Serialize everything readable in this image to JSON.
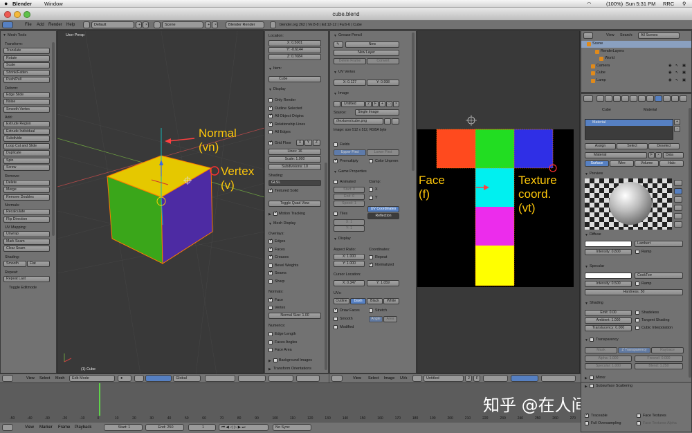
{
  "menubar": {
    "app": "Blender",
    "menu": "Window",
    "battery": "(100%)",
    "clock": "Sun 5:31 PM",
    "user": "RRC"
  },
  "window": {
    "title": "cube.blend"
  },
  "info": {
    "menus": [
      "File",
      "Add",
      "Render",
      "Help"
    ],
    "layout": "Default",
    "scene": "Scene",
    "engine": "Blender Render",
    "stats": "blender.org 262 | Ve:8-8 | Ed:12-12 | Fa:6-6 | Cube"
  },
  "tools": {
    "title": "Mesh Tools",
    "transform_h": "Transform:",
    "transform": [
      "Translate",
      "Rotate",
      "Scale",
      "Shrink/Fatten",
      "Push/Pull"
    ],
    "deform_h": "Deform:",
    "deform": [
      "Edge Slide",
      "Noise",
      "Smooth Vertex"
    ],
    "add_h": "Add:",
    "add": [
      "Extrude Region",
      "Extrude Individual",
      "Subdivide",
      "Loop Cut and Slide",
      "Duplicate",
      "Spin",
      "Screw"
    ],
    "remove_h": "Remove:",
    "remove": [
      "Delete",
      "Merge",
      "Remove Doubles"
    ],
    "normals_h": "Normals:",
    "normals": [
      "Recalculate",
      "Flip Direction"
    ],
    "uv_h": "UV Mapping:",
    "uv": [
      "Unwrap",
      "Mark Seam",
      "Clear Seam"
    ],
    "shading_h": "Shading:",
    "smooth": "Smooth",
    "flat": "Flat",
    "repeat_h": "Repeat:",
    "repeat_last": "Repeat Last",
    "toggle": "Toggle Editmode"
  },
  "viewport": {
    "label": "User Persp",
    "object": "(1) Cube",
    "normal": "Normal\n(vn)",
    "vertex": "Vertex\n(v)",
    "normal_l1": "Normal",
    "normal_l2": "(vn)",
    "vertex_l1": "Vertex",
    "vertex_l2": "(v)"
  },
  "npanel": {
    "location": "Location:",
    "x": "X: 0.5001",
    "y": "Y: -0.6144",
    "z": "Z: 0.7684",
    "item": "Item:",
    "item_name": "Cube",
    "display": "Display",
    "only_render": "Only Render",
    "outline": "Outline Selected",
    "origins": "All Object Origins",
    "rel": "Relationship Lines",
    "all_edges": "All Edges",
    "grid_floor": "Grid Floor",
    "gx": "X",
    "gy": "Y",
    "gz": "Z",
    "lines": "Lines: 16",
    "scale": "Scale: 1.000",
    "subdiv": "Subdivisions: 10",
    "shading": "Shading:",
    "glsl": "GLSL",
    "textured_solid": "Textured Solid",
    "quad_view": "Toggle Quad View",
    "motion": "Motion Tracking",
    "mesh_display": "Mesh Display",
    "overlays": "Overlays:",
    "ov": [
      "Edges",
      "Faces",
      "Creases",
      "Bevel Weights",
      "Seams",
      "Sharp"
    ],
    "normals": "Normals:",
    "face": "Face",
    "vertex": "Vertex",
    "normal_size": "Normal Size: 1.00",
    "numerics": "Numerics:",
    "num": [
      "Edge Length",
      "Faces Angles",
      "Face Area"
    ],
    "bg_images": "Background Images",
    "transform_orient": "Transform Orientations"
  },
  "uvprops": {
    "grease": "Grease Pencil",
    "new": "New",
    "new_layer": "New Layer",
    "delete_frame": "Delete Frame",
    "convert": "Convert",
    "uv_vertex": "UV Vertex",
    "ux": "X: 0.127",
    "uy": "Y: 0.998",
    "image": "Image",
    "untitled": "Untitled",
    "img_count": "2",
    "f": "F",
    "source_l": "Source:",
    "source": "Single Image",
    "path": "//textures/cube.png",
    "info": "Image: size 512 x 512, RGBA byte",
    "fields": "Fields",
    "upper": "Upper First",
    "lower": "Lower First",
    "premult": "Premultiply",
    "unprem": "Color Unprem",
    "game": "Game Properties",
    "animated": "Animated",
    "clamp": "Clamp:",
    "start": "Start: 0",
    "end": "End: 0",
    "speed": "Speed: 1",
    "cx": "X",
    "cy": "Y",
    "tiles": "Tiles",
    "tx": "X: 1",
    "ty": "Y: 1",
    "uv_coords": "UV Coordinates",
    "reflection": "Reflection",
    "display": "Display",
    "aspect": "Aspect Ratio:",
    "coords": "Coordinates:",
    "ax": "X: 1.000",
    "ay": "Y: 1.000",
    "repeat": "Repeat",
    "normalized": "Normalized",
    "cursor": "Cursor Location:",
    "curx": "X: 0.347",
    "cury": "Y: 1.059",
    "uvs": "UVs:",
    "outline": "Outline",
    "dash": "Dash",
    "black": "Black",
    "white": "White",
    "draw_faces": "Draw Faces",
    "stretch": "Stretch",
    "smooth": "Smooth",
    "angle": "Angle",
    "area": "Area",
    "modified": "Modified"
  },
  "uv": {
    "face_l1": "Face",
    "face_l2": "(f)",
    "tex_l1": "Texture",
    "tex_l2": "coord.",
    "tex_l3": "(vt)"
  },
  "outliner": {
    "view": "View",
    "search": "Search:",
    "all_scenes": "All Scenes",
    "items": [
      "Scene",
      "RenderLayers",
      "World",
      "Camera",
      "Cube",
      "Lamp"
    ]
  },
  "props": {
    "cube": "Cube",
    "material": "Material",
    "mat_slot": "Material",
    "assign": "Assign",
    "select": "Select",
    "deselect": "Deselect",
    "mat_name": "Material",
    "data": "Data",
    "tabs": [
      "Surface",
      "Wire",
      "Volume",
      "Halo"
    ],
    "preview": "Preview",
    "diffuse": "Diffuse",
    "lambert": "Lambert",
    "intensity_d": "Intensity: 0.800",
    "ramp": "Ramp",
    "specular": "Specular",
    "cooktorr": "CookTorr",
    "intensity_s": "Intensity: 0.500",
    "hardness": "Hardness: 50",
    "shading": "Shading",
    "emit": "Emit: 0.00",
    "shadeless": "Shadeless",
    "ambient": "Ambient: 1.000",
    "tangent": "Tangent Shading",
    "translucency": "Translucency: 0.000",
    "cubic": "Cubic Interpolation",
    "transparency": "Transparency",
    "mask": "Mask",
    "ztrans": "Z Transparency",
    "raytrace": "Raytrace",
    "alpha": "Alpha: 1.000",
    "fresnel": "Fresnel: 0.000",
    "specular_t": "Specular: 1.000",
    "blend": "Blend: 1.250",
    "mirror": "Mirror",
    "sss": "Subsurface Scattering",
    "traceable": "Traceable",
    "face_tex": "Face Textures",
    "full_over": "Full Oversampling",
    "face_tex_alpha": "Face Textures Alpha"
  },
  "vp_header": {
    "view": "View",
    "select": "Select",
    "mesh": "Mesh",
    "mode": "Edit Mode",
    "pivot": "Global"
  },
  "uv_header": {
    "view": "View",
    "select": "Select",
    "image": "Image",
    "uvs": "UVs",
    "img": "Untitled",
    "n": "2",
    "f": "F"
  },
  "timeline": {
    "ticks": [
      "-50",
      "-40",
      "-30",
      "-20",
      "-10",
      "0",
      "10",
      "20",
      "30",
      "40",
      "50",
      "60",
      "70",
      "80",
      "90",
      "100",
      "110",
      "120",
      "130",
      "140",
      "150",
      "160",
      "170",
      "180",
      "190",
      "200",
      "210",
      "220",
      "230",
      "240",
      "250",
      "260",
      "270",
      "280"
    ],
    "view": "View",
    "marker": "Marker",
    "frame": "Frame",
    "playback": "Playback",
    "start": "Start: 1",
    "end": "End: 250",
    "current": "1",
    "sync": "No Sync"
  },
  "watermark": "知乎 @在人间凑人数"
}
